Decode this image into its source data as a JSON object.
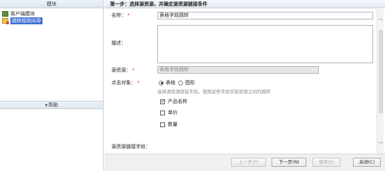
{
  "left": {
    "header": "模块",
    "items": [
      {
        "label": "客户端模块",
        "icon": "module-icon",
        "selected": false
      },
      {
        "label": "跳转规则向导",
        "icon": "rule-wizard-icon",
        "selected": true
      }
    ],
    "help": "帮助"
  },
  "step_title": "第一步：选择源资源，并确定源资源链接条件",
  "form": {
    "name_label": "名称：",
    "name_value": "表格字段跳转",
    "desc_label": "描述：",
    "source_label": "源资源：",
    "source_value": "表格字段跳转",
    "target_label": "点击对象：",
    "radio_table": "表格",
    "radio_graph": "图形",
    "selected_radio": "表格",
    "hint": "选择源资源链接字段，使用这些字段实现资源之间的跳转",
    "checks": [
      {
        "label": "产品名称",
        "checked": true
      },
      {
        "label": "单价",
        "checked": false
      },
      {
        "label": "数量",
        "checked": false
      }
    ],
    "link_fields_label": "源资源链接字段："
  },
  "required_mark": "*",
  "footer": {
    "prev": "上一步(P)",
    "next": "下一步(N)",
    "save": "保存(S)",
    "close": "关闭(C)"
  }
}
